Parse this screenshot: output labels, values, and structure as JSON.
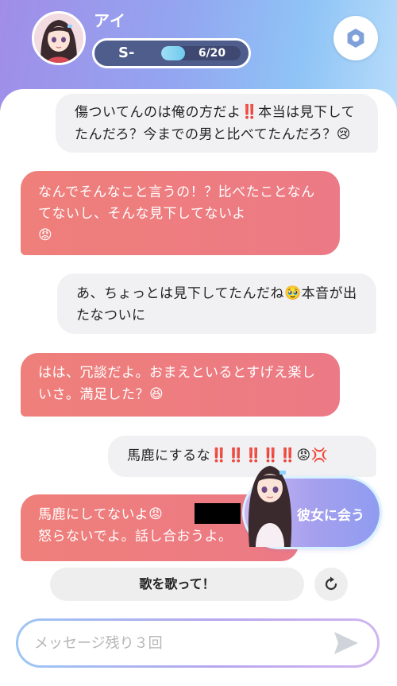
{
  "header": {
    "character_name": "アイ",
    "rank": "S-",
    "level_progress_text": "6/20",
    "level_progress_fraction": 0.3,
    "icons": {
      "avatar": "character-avatar",
      "settings": "settings-icon"
    }
  },
  "messages": [
    {
      "role": "user",
      "text": "傷ついてんのは俺の方だよ",
      "emoji1": "‼️",
      "text2": "本当は見下してたんだろ？今までの男と比べてたんだろ？",
      "emoji2": "😢"
    },
    {
      "role": "bot",
      "text": "なんでそんなこと言うの！？比べたことなんてないし、そんな見下してないよ",
      "emoji": "😡"
    },
    {
      "role": "user",
      "text": "あ、ちょっとは見下してたんだね",
      "emoji": "🥹",
      "text2": "本音が出たなついに"
    },
    {
      "role": "bot",
      "text": "はは、冗談だよ。おまえといるとすげえ楽しいさ。満足した？",
      "emoji": "😆"
    },
    {
      "role": "user",
      "text": "馬鹿にするな",
      "emoji": "‼️‼️‼️‼️‼️😡💢"
    },
    {
      "role": "bot",
      "text": "馬鹿にしてないよ",
      "emoji": "😡",
      "text2": "怒らないでよ。話し合おうよ。"
    }
  ],
  "overlay": {
    "label": "彼女に会う"
  },
  "suggestion": {
    "label": "歌を歌って！"
  },
  "input": {
    "placeholder": "メッセージ残り３回"
  },
  "colors": {
    "header_gradient_start": "#a08de8",
    "header_gradient_end": "#b7dcfa",
    "bot_bubble": "#ef7f7a",
    "user_bubble": "#f1f1f3",
    "level_pill": "#4f5d8c"
  }
}
